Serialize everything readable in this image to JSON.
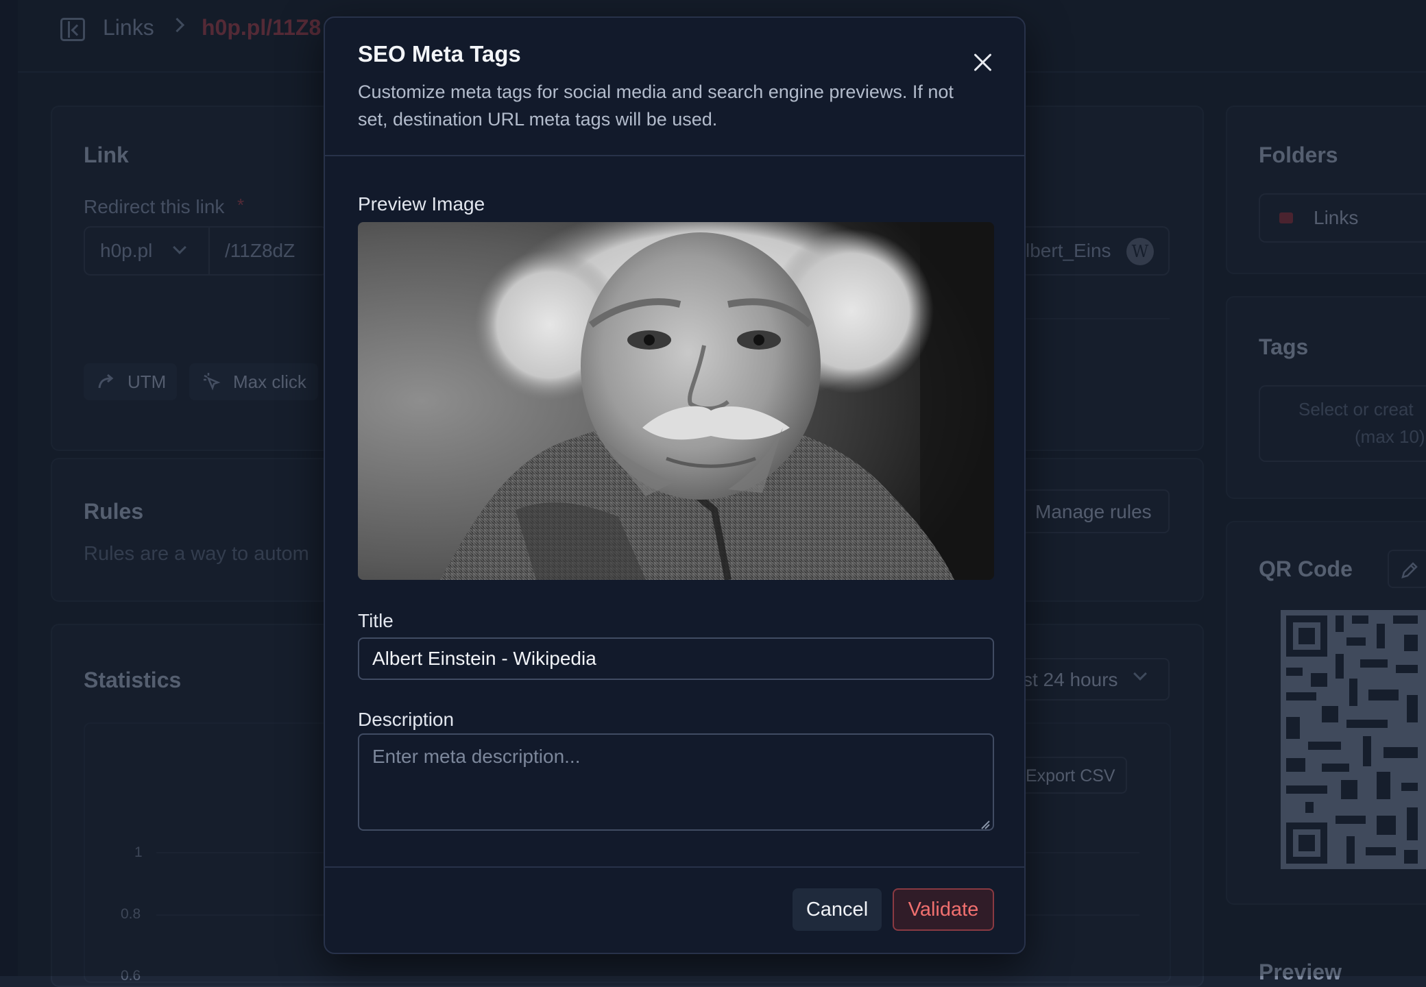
{
  "breadcrumb": {
    "parent": "Links",
    "current": "h0p.pl/11Z8"
  },
  "link_card": {
    "title": "Link",
    "redirect_label": "Redirect this link",
    "required_mark": "*",
    "domain": "h0p.pl",
    "slug": "/11Z8dZ",
    "destination_fragment": "lbert_Eins",
    "destination_badge": "W",
    "utm_button": "UTM",
    "max_click_button": "Max click"
  },
  "rules_card": {
    "title": "Rules",
    "description": "Rules are a way to autom",
    "manage_button": "Manage rules"
  },
  "stats_card": {
    "title": "Statistics",
    "range_select": "st 24 hours",
    "export_button": "Export CSV",
    "y_ticks": [
      "1",
      "0.8",
      "0.6"
    ]
  },
  "sidebar": {
    "folders_title": "Folders",
    "folder_value": "Links",
    "tags_title": "Tags",
    "tags_placeholder_line1": "Select or creat",
    "tags_placeholder_line2": "(max 10)",
    "qr_title": "QR Code",
    "preview_title": "Preview"
  },
  "modal": {
    "title": "SEO Meta Tags",
    "subtitle": "Customize meta tags for social media and search engine previews. If not set, destination URL meta tags will be used.",
    "preview_label": "Preview Image",
    "title_label": "Title",
    "title_value": "Albert Einstein - Wikipedia",
    "description_label": "Description",
    "description_placeholder": "Enter meta description...",
    "cancel": "Cancel",
    "validate": "Validate"
  },
  "colors": {
    "accent": "#f1706f",
    "breadcrumb_current": "#7d3a48",
    "background": "#1b2434",
    "modal": "#121a2b"
  }
}
